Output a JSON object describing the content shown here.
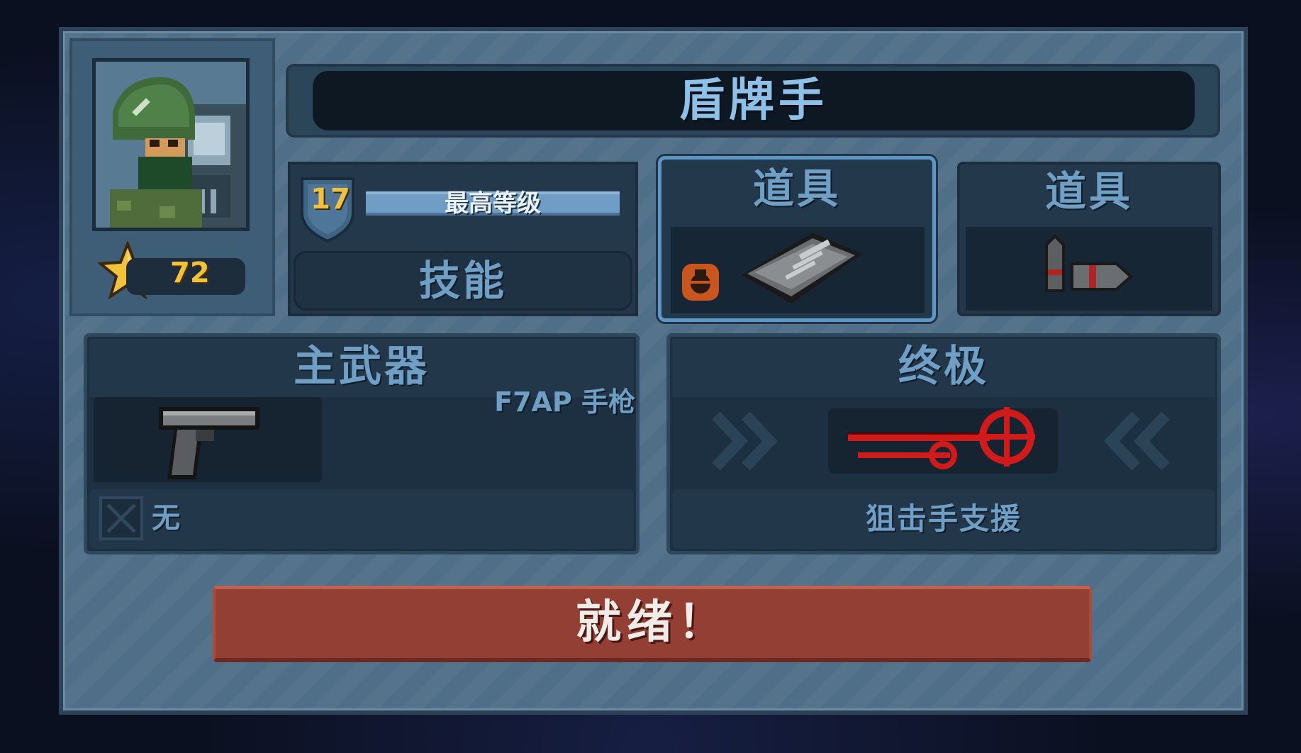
{
  "character": {
    "class_name": "盾牌手",
    "stars": "72",
    "level": "17",
    "level_status": "最高等级",
    "skill_label": "技能"
  },
  "items": [
    {
      "label": "道具",
      "icon": "riot-shield-icon",
      "badge_icon": "grenade-badge-icon",
      "selected": true
    },
    {
      "label": "道具",
      "icon": "ammo-bullets-icon",
      "selected": false
    }
  ],
  "primary_weapon": {
    "label": "主武器",
    "name": "F7AP 手枪",
    "icon": "pistol-icon",
    "attachment": "无"
  },
  "ultimate": {
    "label": "终极",
    "name": "狙击手支援",
    "icon": "sniper-crosshair-icon"
  },
  "ready_button": {
    "label": "就绪！"
  },
  "colors": {
    "panel": "#4f6f88",
    "label_text": "#6f9fc5",
    "ready_button": "#943f33",
    "star": "#f2c23a",
    "selected_border": "#5d97c7"
  }
}
